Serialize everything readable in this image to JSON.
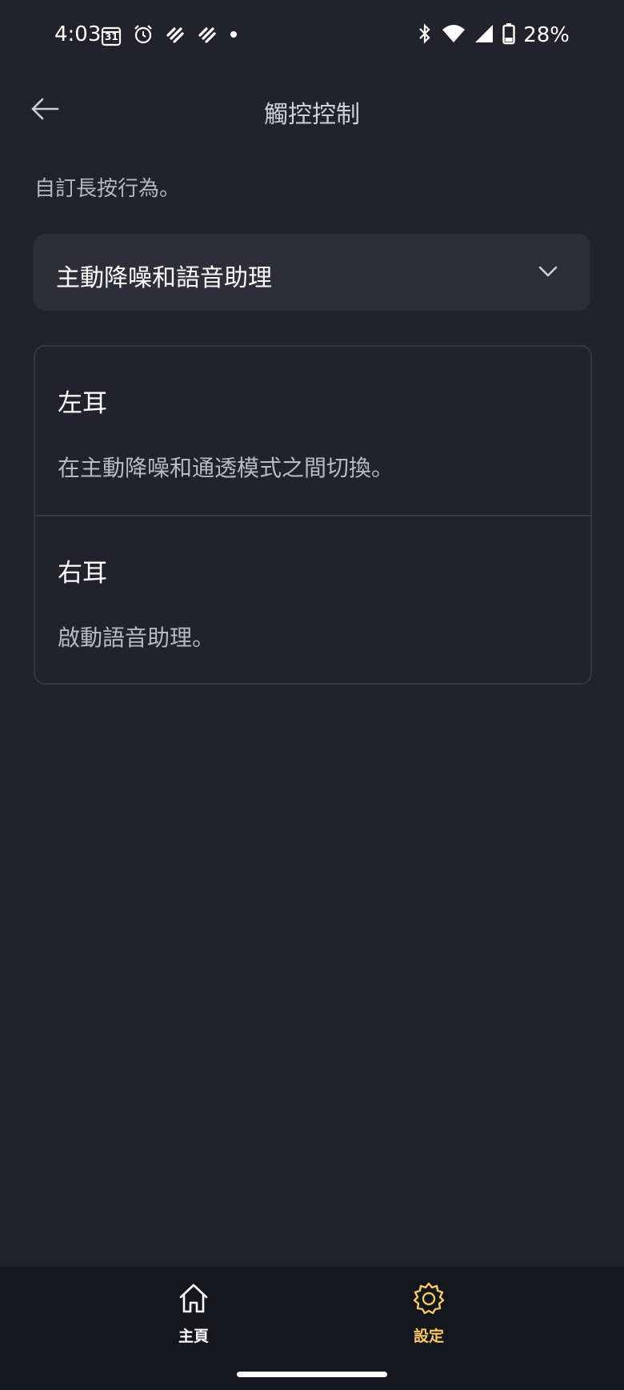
{
  "status_bar": {
    "time": "4:03",
    "calendar_day": "31",
    "battery": "28%"
  },
  "header": {
    "title": "觸控控制"
  },
  "subtitle": "自訂長按行為。",
  "dropdown": {
    "selected": "主動降噪和語音助理"
  },
  "ears": [
    {
      "title": "左耳",
      "description": "在主動降噪和通透模式之間切換。"
    },
    {
      "title": "右耳",
      "description": "啟動語音助理。"
    }
  ],
  "bottom_nav": {
    "items": [
      {
        "label": "主頁",
        "icon": "home-icon",
        "active": false
      },
      {
        "label": "設定",
        "icon": "gear-icon",
        "active": true
      }
    ],
    "active_color": "#f5c86a",
    "inactive_color": "#ffffff"
  },
  "colors": {
    "background": "#21222c",
    "card_fill": "#2d2e38",
    "accent": "#f5c86a"
  }
}
